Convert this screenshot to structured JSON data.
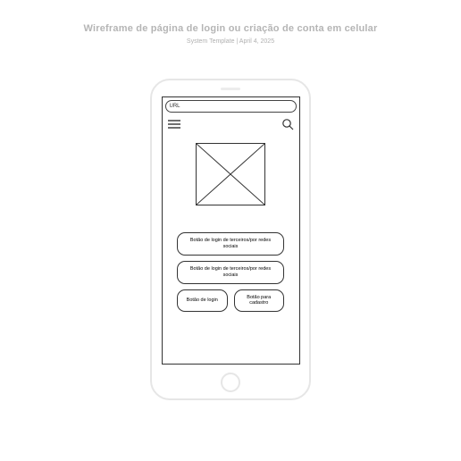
{
  "doc": {
    "title": "Wireframe de página de login ou criação de conta em celular",
    "meta": "System Template  |  April 4, 2025"
  },
  "browser": {
    "url_label": "URL"
  },
  "buttons": {
    "social1": "Botão de login de terceiros/por redes sociais",
    "social2": "Botão de login de terceiros/por redes sociais",
    "login": "Botão de login",
    "signup": "Botão para cadastro"
  }
}
